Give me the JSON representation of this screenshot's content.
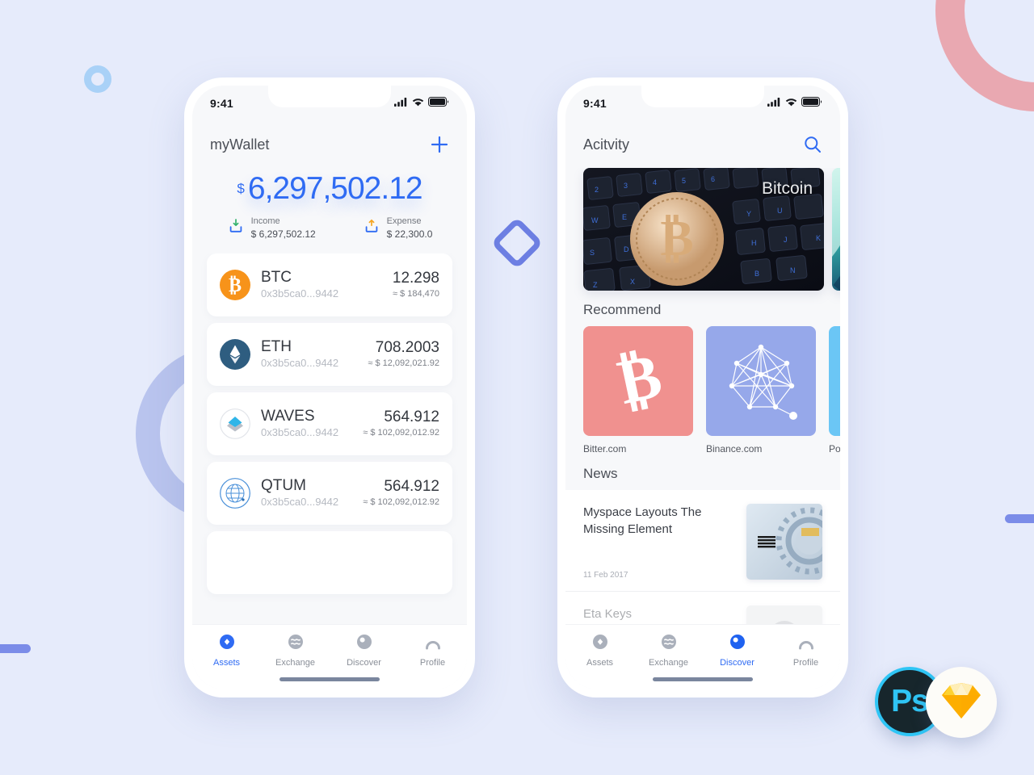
{
  "canvas": {
    "background": "#e6ebfb"
  },
  "decor": {
    "ring_pink": "#e9a8b1",
    "ring_periwinkle": "#b9c4ee",
    "ring_small_blue": "#a9d1f7",
    "bar": "#7b8ce8",
    "diamond": "#6d7fe3"
  },
  "phone_assets": {
    "status": {
      "time": "9:41",
      "signal": "cellular-signal-icon",
      "wifi": "wifi-icon",
      "battery": "battery-full-icon"
    },
    "header": {
      "title": "myWallet",
      "action_icon": "plus-icon"
    },
    "balance": {
      "currency_symbol": "$",
      "amount": "6,297,502.12",
      "accent": "#2f6bf3",
      "income": {
        "label": "Income",
        "value": "$ 6,297,502.12",
        "icon": "tray-download-icon"
      },
      "expense": {
        "label": "Expense",
        "value": "$ 22,300.0",
        "icon": "tray-upload-icon"
      }
    },
    "assets": [
      {
        "symbol": "BTC",
        "address": "0x3b5ca0...9442",
        "amount": "12.298",
        "fiat": "≈ $ 184,470",
        "icon": "bitcoin-coin-icon"
      },
      {
        "symbol": "ETH",
        "address": "0x3b5ca0...9442",
        "amount": "708.2003",
        "fiat": "≈ $ 12,092,021.92",
        "icon": "ethereum-coin-icon"
      },
      {
        "symbol": "WAVES",
        "address": "0x3b5ca0...9442",
        "amount": "564.912",
        "fiat": "≈ $ 102,092,012.92",
        "icon": "waves-coin-icon"
      },
      {
        "symbol": "QTUM",
        "address": "0x3b5ca0...9442",
        "amount": "564.912",
        "fiat": "≈ $ 102,092,012.92",
        "icon": "qtum-coin-icon"
      }
    ],
    "tabs": [
      {
        "label": "Assets",
        "icon": "assets-icon",
        "active": true
      },
      {
        "label": "Exchange",
        "icon": "exchange-icon",
        "active": false
      },
      {
        "label": "Discover",
        "icon": "discover-icon",
        "active": false
      },
      {
        "label": "Profile",
        "icon": "profile-icon",
        "active": false
      }
    ]
  },
  "phone_discover": {
    "status": {
      "time": "9:41",
      "signal": "cellular-signal-icon",
      "wifi": "wifi-icon",
      "battery": "battery-full-icon"
    },
    "header": {
      "title": "Acitvity",
      "action_icon": "search-icon"
    },
    "banners": [
      {
        "label": "Bitcoin",
        "image": "bitcoin-coin-on-keyboard-photo"
      },
      {
        "label": "",
        "image": "teal-abstract-photo"
      }
    ],
    "recommend": {
      "title": "Recommend",
      "items": [
        {
          "name": "Bitter.com",
          "color": "#f0918f",
          "icon": "bitcoin-glyph-icon"
        },
        {
          "name": "Binance.com",
          "color": "#96a8ea",
          "icon": "network-graph-icon"
        },
        {
          "name": "Polonie",
          "color": "#6bc6f5",
          "icon": "poloniex-glyph-icon"
        }
      ]
    },
    "news": {
      "title": "News",
      "items": [
        {
          "title": "Myspace Layouts The Missing Element",
          "date": "11 Feb 2017",
          "thumb": "ibm-logo-photo"
        },
        {
          "title": "Eta Keys",
          "date": "",
          "thumb": "portrait-avatar-photo"
        }
      ]
    },
    "tabs": [
      {
        "label": "Assets",
        "icon": "assets-icon",
        "active": false
      },
      {
        "label": "Exchange",
        "icon": "exchange-icon",
        "active": false
      },
      {
        "label": "Discover",
        "icon": "discover-icon",
        "active": true
      },
      {
        "label": "Profile",
        "icon": "profile-icon",
        "active": false
      }
    ]
  },
  "badges": {
    "photoshop": "Ps",
    "sketch": "sketch-diamond-icon"
  }
}
